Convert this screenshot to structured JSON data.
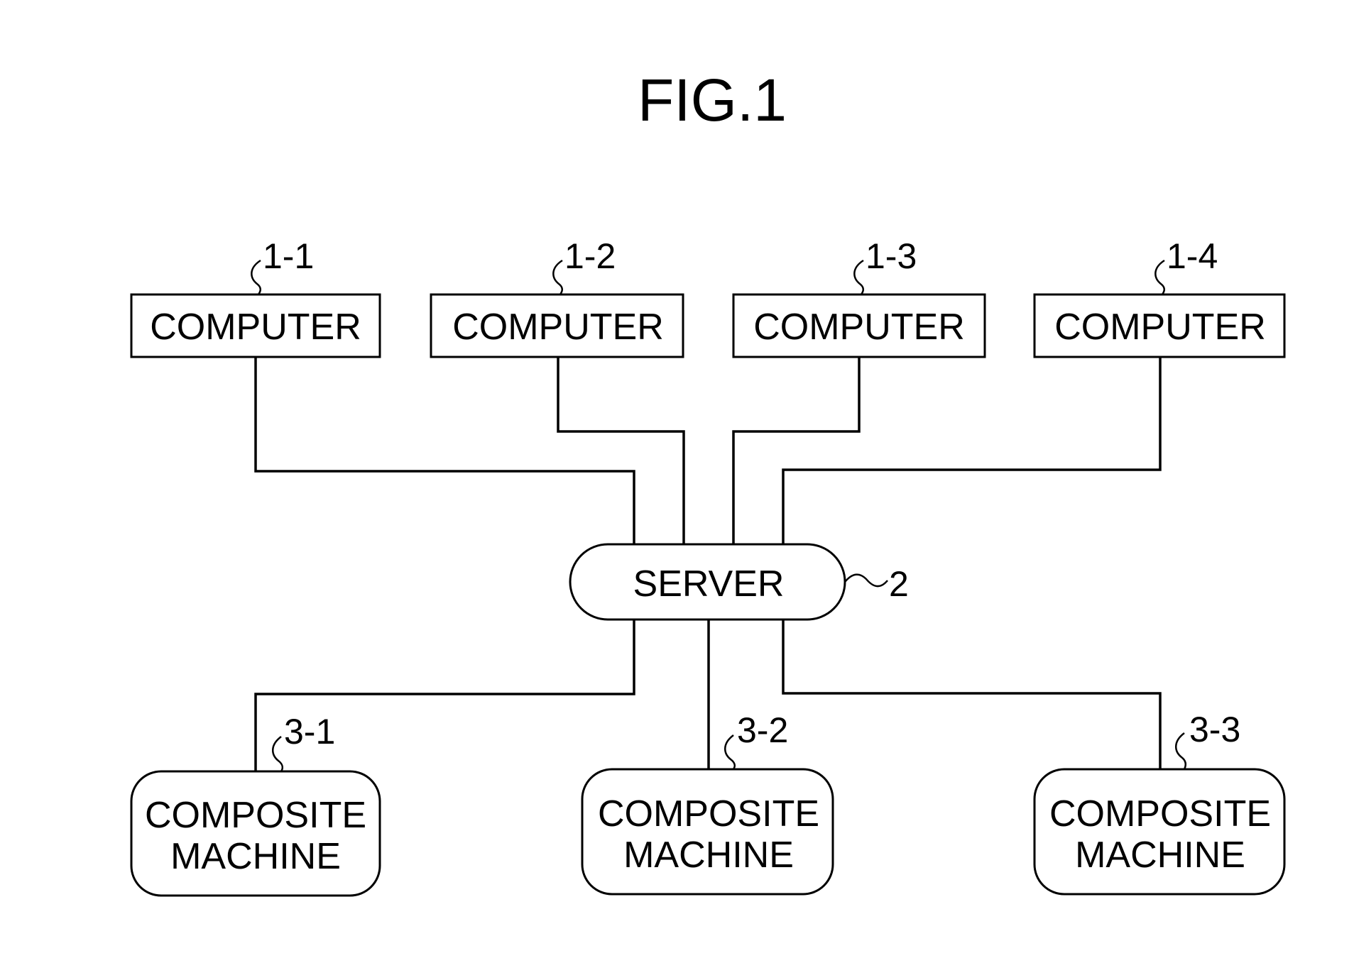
{
  "figure": {
    "title": "FIG.1"
  },
  "nodes": {
    "computers": [
      {
        "ref": "1-1",
        "label": "COMPUTER"
      },
      {
        "ref": "1-2",
        "label": "COMPUTER"
      },
      {
        "ref": "1-3",
        "label": "COMPUTER"
      },
      {
        "ref": "1-4",
        "label": "COMPUTER"
      }
    ],
    "server": {
      "ref": "2",
      "label": "SERVER"
    },
    "machines": [
      {
        "ref": "3-1",
        "label_line1": "COMPOSITE",
        "label_line2": "MACHINE"
      },
      {
        "ref": "3-2",
        "label_line1": "COMPOSITE",
        "label_line2": "MACHINE"
      },
      {
        "ref": "3-3",
        "label_line1": "COMPOSITE",
        "label_line2": "MACHINE"
      }
    ]
  },
  "edges": [
    {
      "from": "1-1",
      "to": "2"
    },
    {
      "from": "1-2",
      "to": "2"
    },
    {
      "from": "1-3",
      "to": "2"
    },
    {
      "from": "1-4",
      "to": "2"
    },
    {
      "from": "2",
      "to": "3-1"
    },
    {
      "from": "2",
      "to": "3-2"
    },
    {
      "from": "2",
      "to": "3-3"
    }
  ]
}
